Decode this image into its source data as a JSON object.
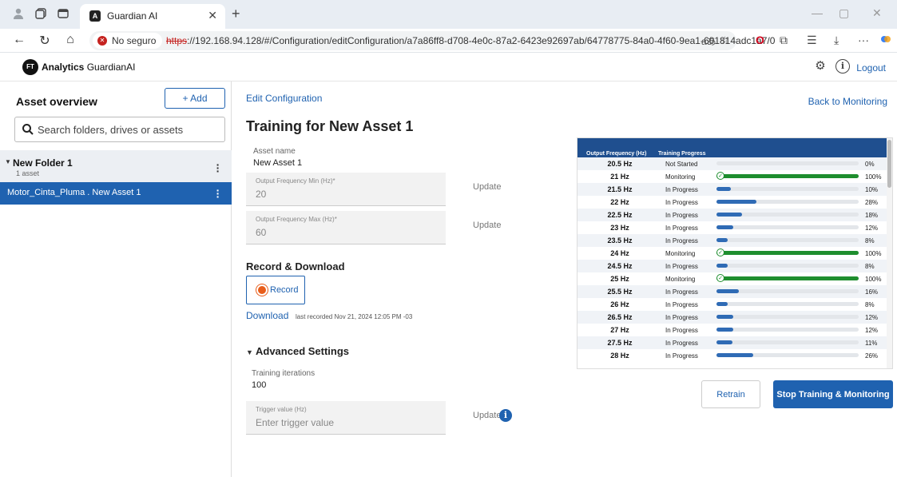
{
  "browser": {
    "tab_title": "Guardian AI",
    "security_label": "No seguro",
    "url_protocol": "https",
    "url_rest": "://192.168.94.128/#/Configuration/editConfiguration/a7a86ff8-d708-4e0c-87a2-6423e92697ab/64778775-84a0-4f60-9ea1-601814adc1a7/0",
    "read_aloud": "aあ"
  },
  "header": {
    "logo_mark": "FT",
    "logo_bold": "Analytics",
    "logo_rest": "GuardianAI",
    "logout_label": "Logout"
  },
  "sidebar": {
    "title": "Asset overview",
    "add_label": "+ Add",
    "search_placeholder": "Search folders, drives or assets",
    "folder": {
      "name": "New Folder 1",
      "count": "1 asset"
    },
    "asset": {
      "name": "Motor_Cinta_Pluma . New Asset 1"
    }
  },
  "main": {
    "breadcrumb": "Edit Configuration",
    "back_label": "Back to Monitoring",
    "title": "Training for New Asset 1",
    "asset_name_label": "Asset name",
    "asset_name_value": "New Asset 1",
    "freq_min_label": "Output Frequency Min (Hz)*",
    "freq_min_value": "20",
    "freq_max_label": "Output Frequency Max (Hz)*",
    "freq_max_value": "60",
    "update_label": "Update",
    "record_section": "Record & Download",
    "record_label": "Record",
    "download_label": "Download",
    "last_recorded": "last recorded Nov 21, 2024 12:05 PM -03",
    "advanced_label": "Advanced Settings",
    "iterations_label": "Training iterations",
    "iterations_value": "100",
    "trigger_label": "Trigger value (Hz)",
    "trigger_placeholder": "Enter trigger value",
    "retrain_label": "Retrain",
    "stop_label": "Stop Training & Monitoring"
  },
  "training_table": {
    "headers": [
      "Output Frequency (Hz)",
      "Training Progress"
    ],
    "rows": [
      {
        "freq": "20.5 Hz",
        "status": "Not Started",
        "progress": 0,
        "pct": "0%"
      },
      {
        "freq": "21 Hz",
        "status": "Monitoring",
        "progress": 100,
        "pct": "100%"
      },
      {
        "freq": "21.5 Hz",
        "status": "In Progress",
        "progress": 10,
        "pct": "10%"
      },
      {
        "freq": "22 Hz",
        "status": "In Progress",
        "progress": 28,
        "pct": "28%"
      },
      {
        "freq": "22.5 Hz",
        "status": "In Progress",
        "progress": 18,
        "pct": "18%"
      },
      {
        "freq": "23 Hz",
        "status": "In Progress",
        "progress": 12,
        "pct": "12%"
      },
      {
        "freq": "23.5 Hz",
        "status": "In Progress",
        "progress": 8,
        "pct": "8%"
      },
      {
        "freq": "24 Hz",
        "status": "Monitoring",
        "progress": 100,
        "pct": "100%"
      },
      {
        "freq": "24.5 Hz",
        "status": "In Progress",
        "progress": 8,
        "pct": "8%"
      },
      {
        "freq": "25 Hz",
        "status": "Monitoring",
        "progress": 100,
        "pct": "100%"
      },
      {
        "freq": "25.5 Hz",
        "status": "In Progress",
        "progress": 16,
        "pct": "16%"
      },
      {
        "freq": "26 Hz",
        "status": "In Progress",
        "progress": 8,
        "pct": "8%"
      },
      {
        "freq": "26.5 Hz",
        "status": "In Progress",
        "progress": 12,
        "pct": "12%"
      },
      {
        "freq": "27 Hz",
        "status": "In Progress",
        "progress": 12,
        "pct": "12%"
      },
      {
        "freq": "27.5 Hz",
        "status": "In Progress",
        "progress": 11,
        "pct": "11%"
      },
      {
        "freq": "28 Hz",
        "status": "In Progress",
        "progress": 26,
        "pct": "26%"
      }
    ]
  },
  "colors": {
    "accent": "#1f62b0",
    "table_header": "#1f4f8f",
    "progress_in": "#2f6bb5",
    "progress_done": "#1e8e2e"
  },
  "icons": [
    "profile-icon",
    "collections-icon",
    "tab-actions-icon",
    "back-icon",
    "refresh-icon",
    "home-icon",
    "favorite-icon",
    "opera-icon",
    "extensions-icon",
    "favorites-bar-icon",
    "download-icon",
    "more-icon",
    "settings-icon",
    "info-icon",
    "search-icon",
    "kebab-icon"
  ]
}
